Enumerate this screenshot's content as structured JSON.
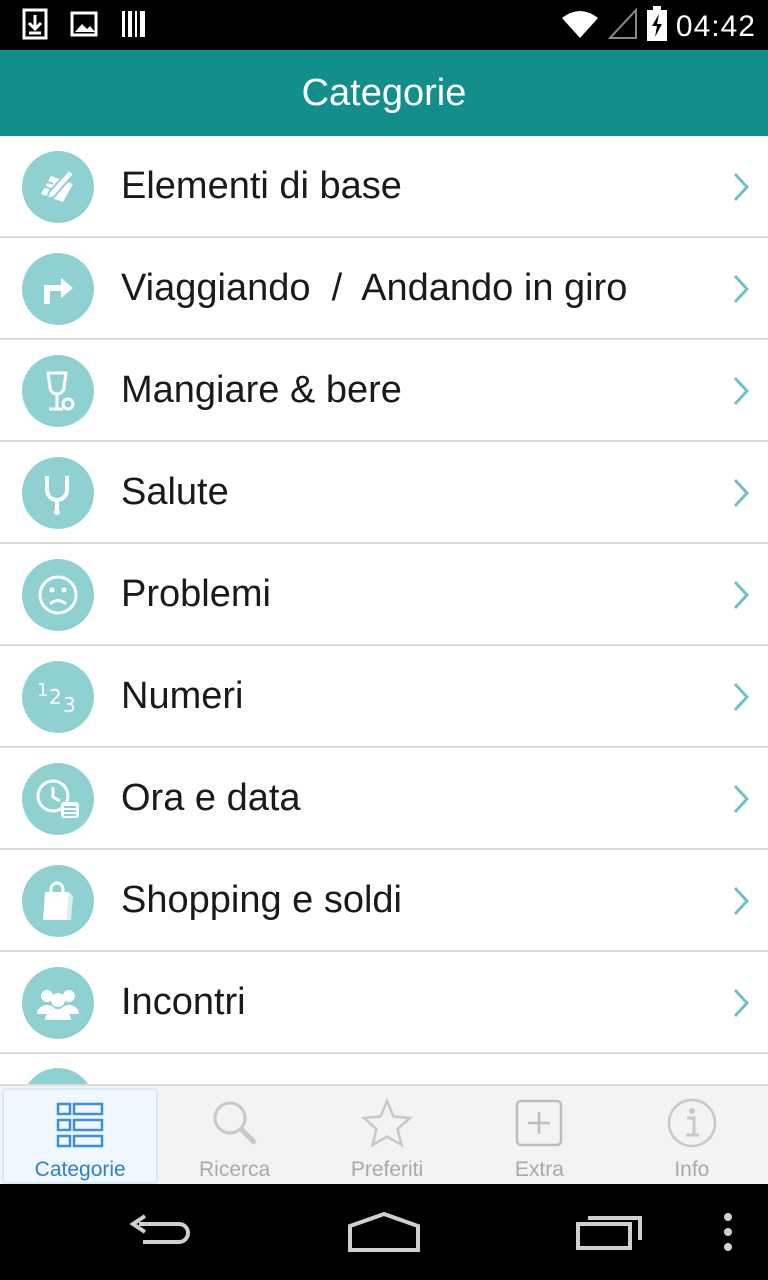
{
  "status_bar": {
    "time": "04:42",
    "left_icons": [
      "download-icon",
      "image-icon",
      "barcode-icon"
    ],
    "right_icons": [
      "wifi-icon",
      "signal-icon",
      "battery-charging-icon"
    ]
  },
  "header": {
    "title": "Categorie",
    "background": "#138f8b"
  },
  "categories": [
    {
      "label": "Elementi di base",
      "icon": "pencil-paper-icon"
    },
    {
      "label": "Viaggiando  /  Andando in giro",
      "icon": "turn-arrow-icon"
    },
    {
      "label": "Mangiare & bere",
      "icon": "glass-icon"
    },
    {
      "label": "Salute",
      "icon": "stethoscope-icon"
    },
    {
      "label": "Problemi",
      "icon": "sad-face-icon"
    },
    {
      "label": "Numeri",
      "icon": "numbers-icon"
    },
    {
      "label": "Ora e data",
      "icon": "clock-calendar-icon"
    },
    {
      "label": "Shopping e soldi",
      "icon": "shopping-bag-icon"
    },
    {
      "label": "Incontri",
      "icon": "people-icon"
    }
  ],
  "tabs": [
    {
      "label": "Categorie",
      "icon": "list-grid-icon",
      "active": true
    },
    {
      "label": "Ricerca",
      "icon": "magnifier-icon",
      "active": false
    },
    {
      "label": "Preferiti",
      "icon": "star-icon",
      "active": false
    },
    {
      "label": "Extra",
      "icon": "plus-box-icon",
      "active": false
    },
    {
      "label": "Info",
      "icon": "info-icon",
      "active": false
    }
  ],
  "nav_bar": {
    "buttons": [
      "back-icon",
      "home-icon",
      "recent-apps-icon",
      "overflow-menu-icon"
    ]
  },
  "colors": {
    "accent": "#138f8b",
    "icon_circle": "#8fd1d1",
    "chevron": "#6fc3c3",
    "active_tab": "#2e7fd6"
  }
}
